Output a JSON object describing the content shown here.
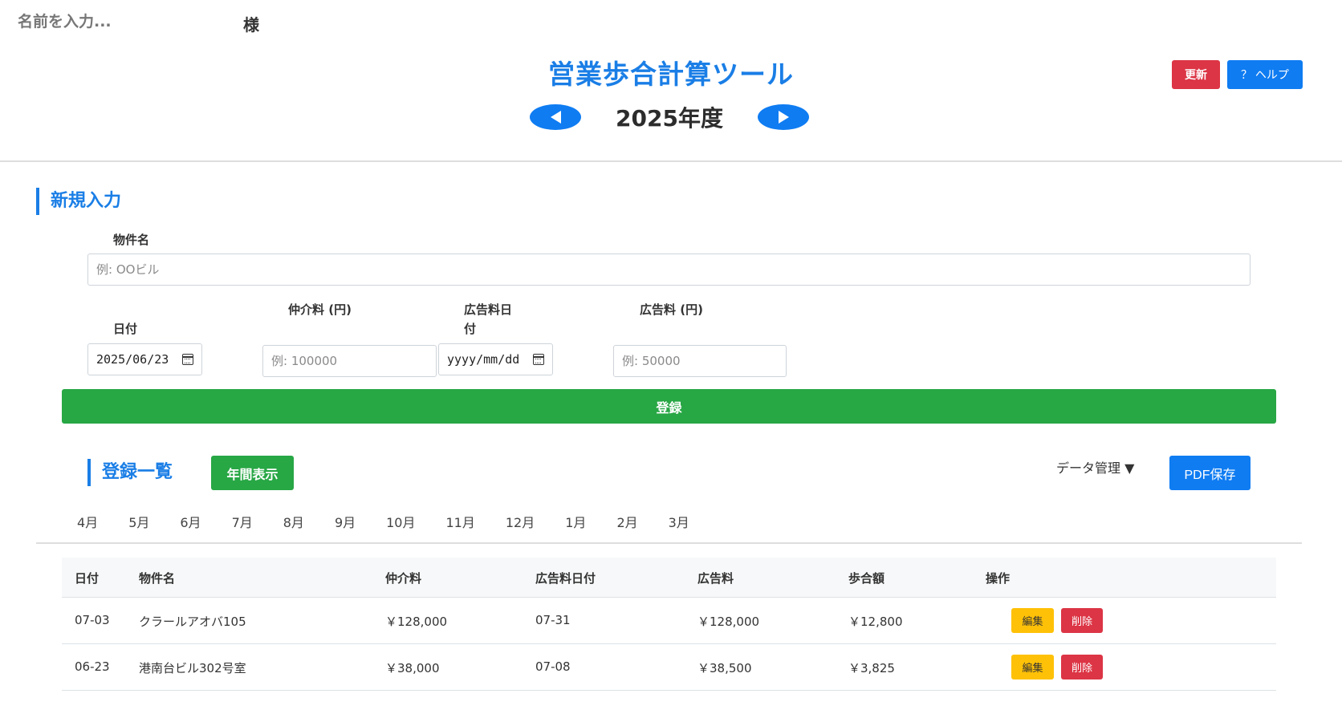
{
  "header": {
    "name_placeholder": "名前を入力...",
    "honorific": "様",
    "title": "営業歩合計算ツール",
    "fiscal_year": "2025年度",
    "refresh_label": "更新",
    "help_label": "？ ヘルプ"
  },
  "new_entry": {
    "section_title": "新規入力",
    "property_label": "物件名",
    "property_placeholder": "例: OOビル",
    "date_label": "日付",
    "date_value": "2025/06/23",
    "fee_label": "仲介料 (円)",
    "fee_placeholder": "例: 100000",
    "ad_date_label": "広告料日付",
    "ad_date_value": "yyyy/mm/dd",
    "ad_fee_label": "広告料 (円)",
    "ad_fee_placeholder": "例: 50000",
    "register_label": "登録"
  },
  "list": {
    "section_title": "登録一覧",
    "annual_label": "年間表示",
    "data_mgmt_label": "データ管理 ▼",
    "pdf_label": "PDF保存",
    "months": [
      "4月",
      "5月",
      "6月",
      "7月",
      "8月",
      "9月",
      "10月",
      "11月",
      "12月",
      "1月",
      "2月",
      "3月"
    ],
    "columns": {
      "date": "日付",
      "property": "物件名",
      "fee": "仲介料",
      "ad_date": "広告料日付",
      "ad_fee": "広告料",
      "commission": "歩合額",
      "ops": "操作"
    },
    "rows": [
      {
        "date": "07-03",
        "property": "クラールアオバ105",
        "fee": "￥128,000",
        "ad_date": "07-31",
        "ad_fee": "￥128,000",
        "commission": "￥12,800"
      },
      {
        "date": "06-23",
        "property": "港南台ビル302号室",
        "fee": "￥38,000",
        "ad_date": "07-08",
        "ad_fee": "￥38,500",
        "commission": "￥3,825"
      }
    ],
    "edit_label": "編集",
    "delete_label": "削除"
  }
}
